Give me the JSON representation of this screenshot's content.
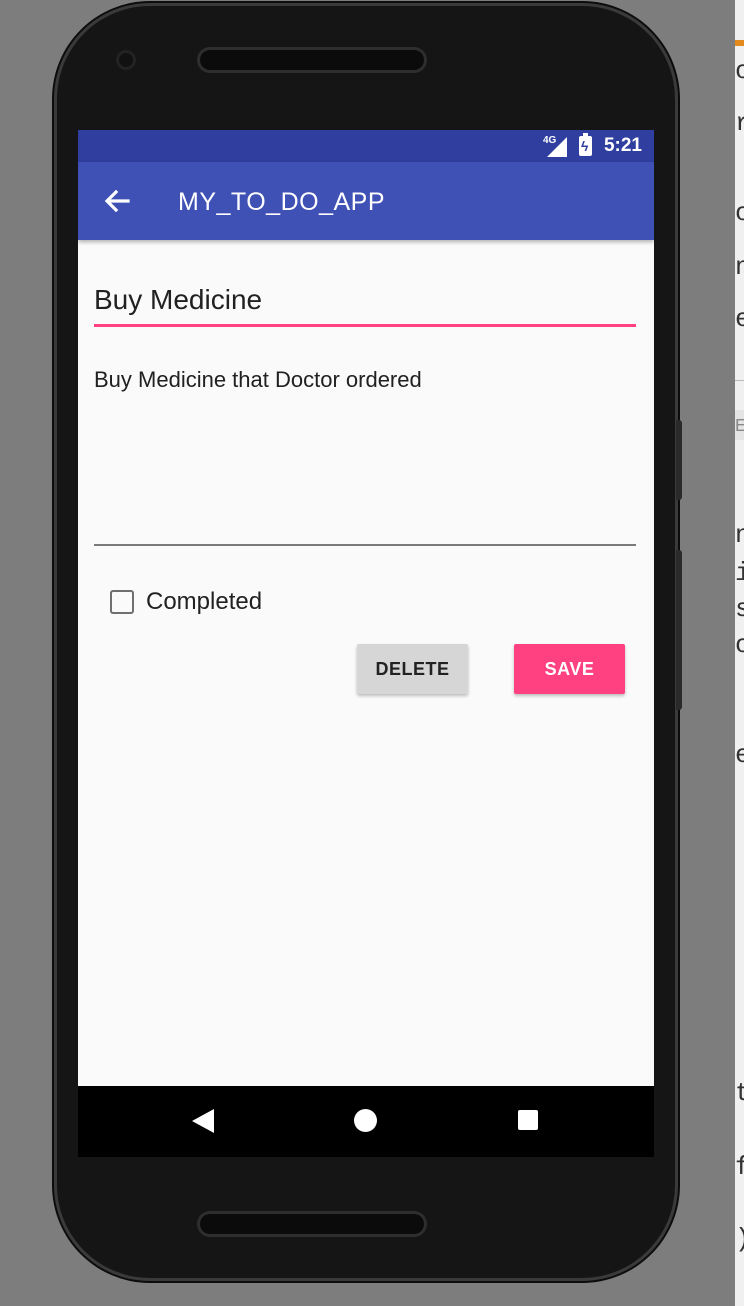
{
  "status_bar": {
    "network": "4G",
    "time": "5:21"
  },
  "app_bar": {
    "title": "MY_TO_DO_APP",
    "back_icon": "arrow-back-icon"
  },
  "form": {
    "title_value": "Buy Medicine",
    "description_value": "Buy Medicine that Doctor ordered",
    "completed_label": "Completed",
    "completed_checked": false
  },
  "buttons": {
    "delete_label": "DELETE",
    "save_label": "SAVE"
  },
  "nav_bar": {
    "icons": [
      "nav-back-icon",
      "nav-home-icon",
      "nav-recents-icon"
    ]
  },
  "colors": {
    "status_bar": "#303f9f",
    "app_bar": "#3f51b5",
    "accent": "#ff4081",
    "background": "#fafafa"
  },
  "background_editor_chars": [
    "o",
    "r",
    "o",
    "n",
    "e",
    "E",
    "n",
    "i",
    "s",
    "o",
    "e",
    "t",
    "f",
    ")"
  ]
}
